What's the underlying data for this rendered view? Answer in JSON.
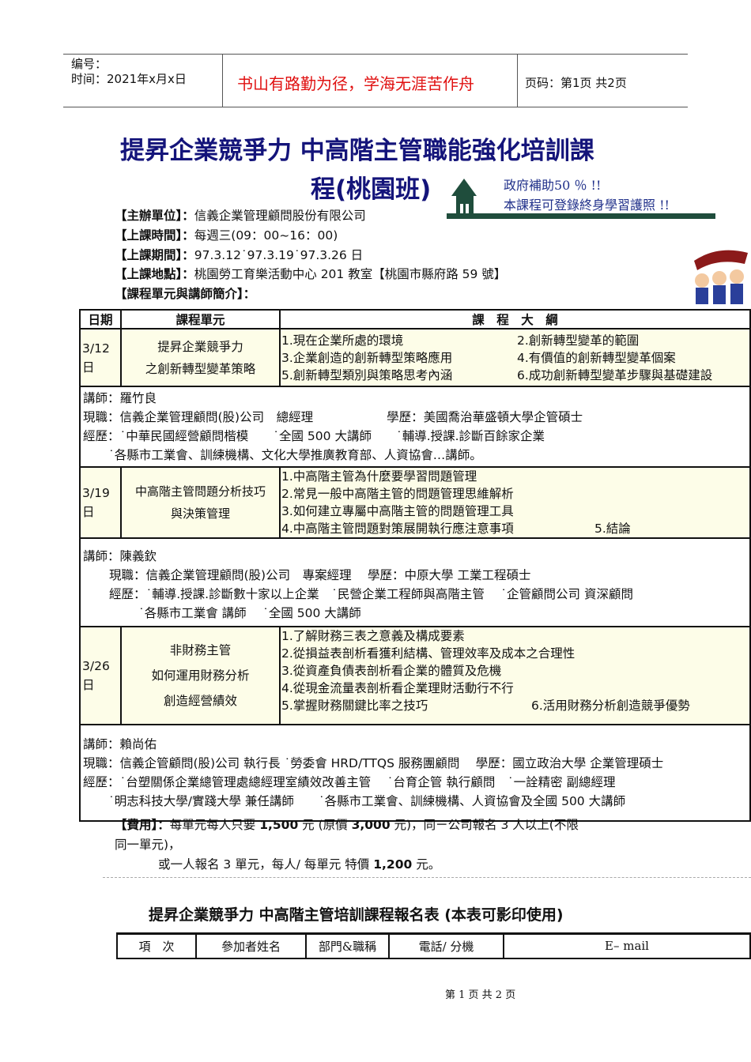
{
  "header": {
    "number_label": "编号：",
    "time_label": "时间：2021年x月x日",
    "slogan": "书山有路勤为径，学海无涯苦作舟",
    "page_label": "页码：第1页  共2页"
  },
  "title": {
    "line1": "提昇企業競爭力 中高階主管職能強化培訓課",
    "line2": "程(桃園班)"
  },
  "banner": {
    "line1": "政府補助50 ％ !!",
    "line2": "本課程可登錄終身學習護照 !!"
  },
  "info": [
    {
      "label": "【主辦單位】：",
      "value": "信義企業管理顧問股份有限公司"
    },
    {
      "label": "【上課時間】：",
      "value": "每週三(09：00~16：00)"
    },
    {
      "label": "【上課期間】：",
      "value": "97.3.12˙97.3.19˙97.3.26 日"
    },
    {
      "label": "【上課地點】：",
      "value": "桃園勞工育樂活動中心 201 教室【桃園市縣府路 59 號】"
    },
    {
      "label": "【課程單元與講師簡介】：",
      "value": ""
    }
  ],
  "table": {
    "headers": [
      "日期",
      "課程單元",
      "課　程　大　綱"
    ],
    "rows": [
      {
        "date": "3/12\n日",
        "unit": [
          "提昇企業競爭力",
          "之創新轉型變革策略"
        ],
        "outline": [
          [
            "1.現在企業所處的環境",
            "2.創新轉型變革的範圍"
          ],
          [
            "3.企業創造的創新轉型策略應用",
            "4.有價值的創新轉型變革個案"
          ],
          [
            "5.創新轉型類別與策略思考內涵",
            "6.成功創新轉型變革步驟與基礎建設"
          ]
        ],
        "instructor": [
          "講師：羅竹良",
          "現職：信義企業管理顧問(股)公司　總經理　　　　　　學歷：美國喬治華盛頓大學企管碩士",
          "經歷：˙中華民國經營顧問楷模　　˙全國 500 大講師　　˙輔導.授課.診斷百餘家企業",
          "˙各縣市工業會、訓練機構、文化大學推廣教育部、人資協會…講師。"
        ]
      },
      {
        "date": "3/19\n日",
        "unit": [
          "中高階主管問題分析技巧",
          "與決策管理"
        ],
        "outline": [
          [
            "1.中高階主管為什麼要學習問題管理",
            ""
          ],
          [
            "2.常見一般中高階主管的問題管理思維解析",
            ""
          ],
          [
            "3.如何建立專屬中高階主管的問題管理工具",
            ""
          ],
          [
            "4.中高階主管問題對策展開執行應注意事項",
            "5.結論"
          ]
        ],
        "instructor": [
          "講師：陳義欽",
          "現職：信義企業管理顧問(股)公司　專案經理　 學歷：中原大學 工業工程碩士",
          "經歷：˙輔導.授課.診斷數十家以上企業　˙民營企業工程師與高階主管　 ˙企管顧問公司 資深顧問",
          "˙各縣市工業會 講師　 ˙全國 500 大講師"
        ]
      },
      {
        "date": "3/26\n日",
        "unit": [
          "非財務主管",
          "如何運用財務分析",
          "創造經營績效"
        ],
        "outline": [
          [
            "1.了解財務三表之意義及構成要素",
            ""
          ],
          [
            "2.從損益表剖析看獲利結構、管理效率及成本之合理性",
            ""
          ],
          [
            "3.從資產負債表剖析看企業的體質及危機",
            ""
          ],
          [
            "4.從現金流量表剖析看企業理財活動行不行",
            ""
          ],
          [
            "5.掌握財務關鍵比率之技巧",
            "6.活用財務分析創造競爭優勢"
          ]
        ],
        "instructor": [
          "講師：賴尚佑",
          "現職：信義企管顧問(股)公司 執行長 ˙勞委會 HRD/TTQS 服務團顧問　 學歷：國立政治大學 企業管理碩士",
          "經歷：˙台塑關係企業總管理處總經理室績效改善主管　 ˙台育企管 執行顧問　˙一詮精密 副總經理",
          "˙明志科技大學/實踐大學 兼任講師　　˙各縣市工業會、訓練機構、人資協會及全國 500 大講師"
        ]
      }
    ]
  },
  "fee": {
    "label": "【費用】：",
    "line1a": "每單元每人只要 ",
    "p1": "1,500",
    "line1b": " 元 (原價 ",
    "p2": "3,000",
    "line1c": " 元)，同ㄧ公司報名 3 人以上(不限",
    "line2": "同一單元)，",
    "line3a": "或一人報名 3 單元，每人/ 每單元 特價 ",
    "p3": "1,200",
    "line3b": " 元。"
  },
  "form": {
    "title": "提昇企業競爭力  中高階主管培訓課程報名表 (本表可影印使用)",
    "headers": [
      "項　次",
      "參加者姓名",
      "部門&職稱",
      "電話/ 分機",
      "E– mail"
    ]
  },
  "footer": {
    "page": "第 1 页 共 2 页"
  }
}
